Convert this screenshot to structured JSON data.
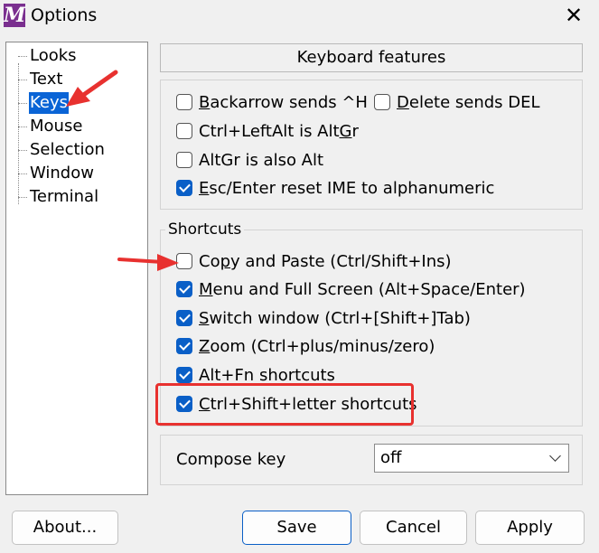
{
  "window": {
    "title": "Options",
    "icon_letter": "M",
    "close_glyph": "✕"
  },
  "sidebar": {
    "items": [
      {
        "label": "Looks"
      },
      {
        "label": "Text"
      },
      {
        "label": "Keys"
      },
      {
        "label": "Mouse"
      },
      {
        "label": "Selection"
      },
      {
        "label": "Window"
      },
      {
        "label": "Terminal"
      }
    ],
    "selected": "Keys"
  },
  "header": {
    "title": "Keyboard features"
  },
  "features": {
    "backarrow": {
      "pre": "",
      "u": "B",
      "post": "ackarrow sends ^H",
      "checked": false
    },
    "delete": {
      "pre": "",
      "u": "D",
      "post": "elete sends DEL",
      "checked": false
    },
    "ctrl_altgr": {
      "pre": "Ctrl+LeftAlt is Alt",
      "u": "G",
      "post": "r",
      "checked": false
    },
    "altgr_alt": {
      "pre": "AltGr is also Alt",
      "u": "",
      "post": "",
      "checked": false
    },
    "esc_reset": {
      "pre": "",
      "u": "E",
      "post": "sc/Enter reset IME to alphanumeric",
      "checked": true
    }
  },
  "shortcuts": {
    "caption": "Shortcuts",
    "items": [
      {
        "pre": "Co",
        "u": "p",
        "post": "y and Paste (Ctrl/Shift+Ins)",
        "checked": false
      },
      {
        "pre": "",
        "u": "M",
        "post": "enu and Full Screen (Alt+Space/Enter)",
        "checked": true
      },
      {
        "pre": "",
        "u": "S",
        "post": "witch window (Ctrl+[Shift+]Tab)",
        "checked": true
      },
      {
        "pre": "",
        "u": "Z",
        "post": "oom (Ctrl+plus/minus/zero)",
        "checked": true
      },
      {
        "pre": "Alt+Fn shortcuts",
        "u": "",
        "post": "",
        "checked": true
      },
      {
        "pre": "",
        "u": "C",
        "post": "trl+Shift+letter shortcuts",
        "checked": true
      }
    ]
  },
  "compose": {
    "label": "Compose key",
    "value": "off"
  },
  "buttons": {
    "about": "About...",
    "save": "Save",
    "cancel": "Cancel",
    "apply": "Apply"
  },
  "colors": {
    "accent": "#0a5fc7",
    "annotation": "#e8312f"
  }
}
